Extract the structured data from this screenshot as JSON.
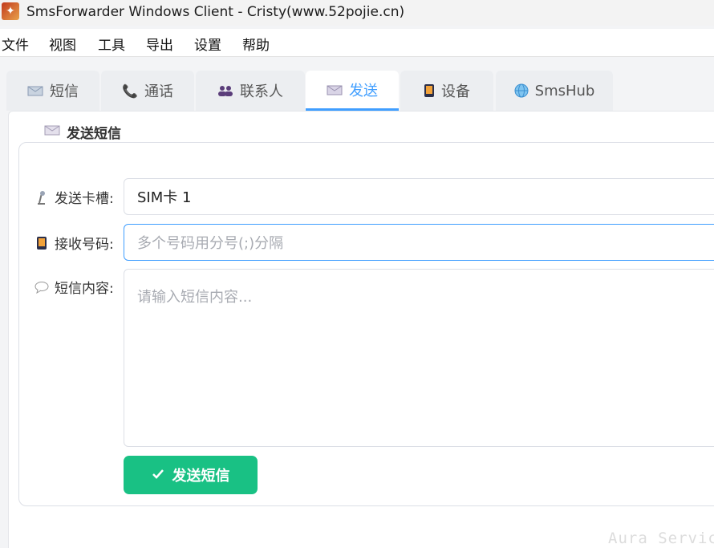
{
  "window": {
    "title": "SmsForwarder Windows Client - Cristy(www.52pojie.cn)",
    "app_icon": "app-logo-icon"
  },
  "menu": {
    "items": [
      "文件",
      "视图",
      "工具",
      "导出",
      "设置",
      "帮助"
    ]
  },
  "tabs": [
    {
      "label": "短信",
      "icon": "sms-icon"
    },
    {
      "label": "通话",
      "icon": "phone-icon"
    },
    {
      "label": "联系人",
      "icon": "contacts-icon"
    },
    {
      "label": "发送",
      "icon": "envelope-icon",
      "active": true
    },
    {
      "label": "设备",
      "icon": "device-icon"
    },
    {
      "label": "SmsHub",
      "icon": "globe-icon"
    }
  ],
  "section": {
    "title": "发送短信",
    "icon": "envelope-icon"
  },
  "form": {
    "sim_label": "发送卡槽:",
    "sim_value": "SIM卡 1",
    "phone_label": "接收号码:",
    "phone_placeholder": "多个号码用分号(;)分隔",
    "content_label": "短信内容:",
    "content_placeholder": "请输入短信内容...",
    "send_button": "发送短信"
  },
  "watermark": "Aura Service",
  "colors": {
    "accent": "#409eff",
    "send_button": "#19c184"
  }
}
